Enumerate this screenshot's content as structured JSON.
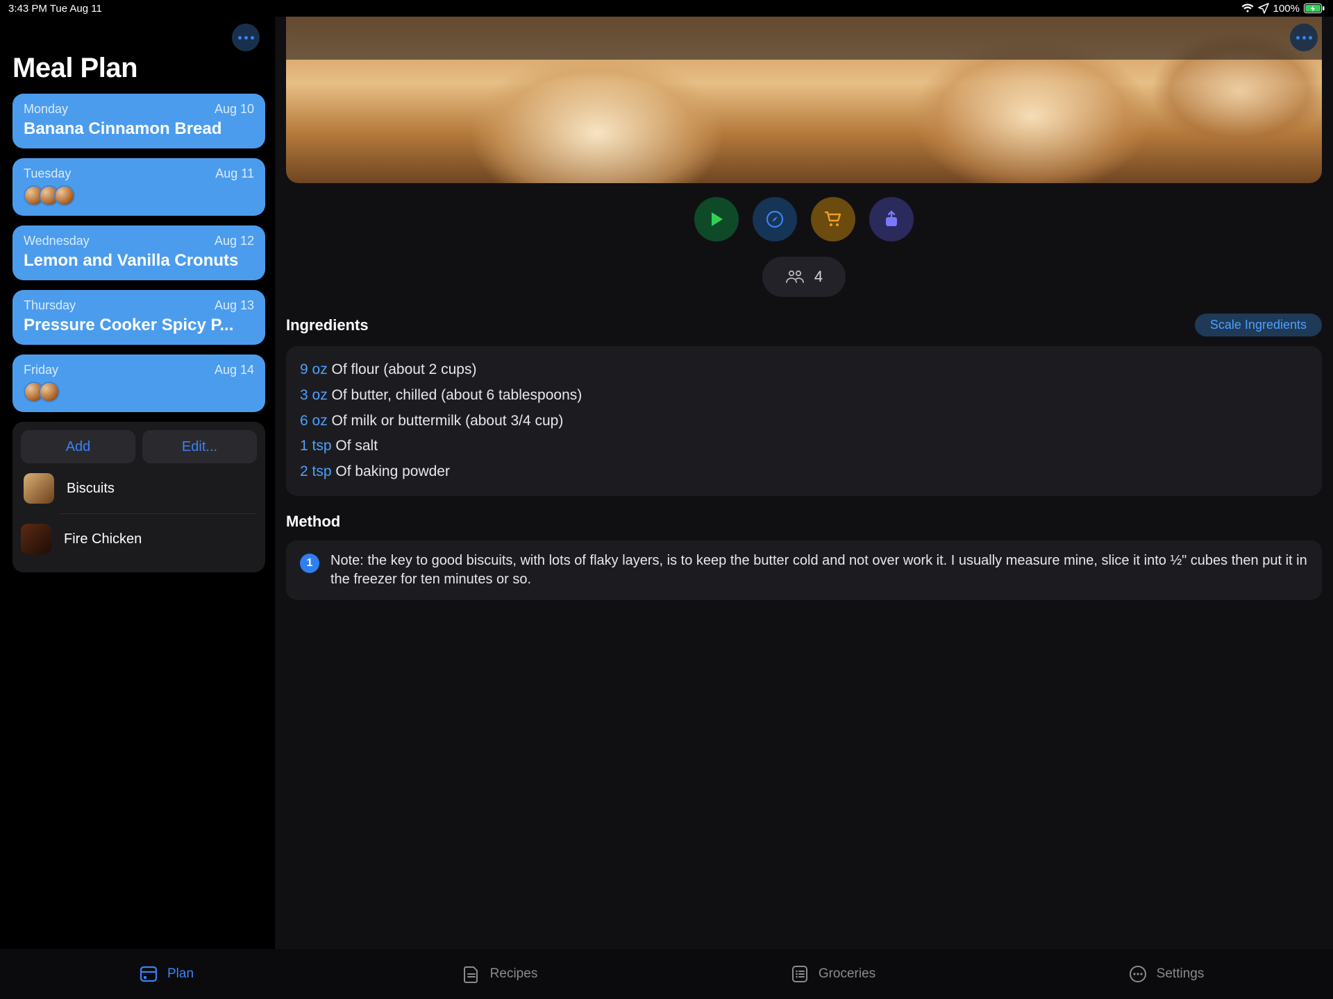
{
  "statusbar": {
    "time_day": "3:43 PM   Tue Aug 11",
    "battery": "100%"
  },
  "sidebar": {
    "title": "Meal Plan",
    "days": [
      {
        "name": "Monday",
        "date": "Aug 10",
        "meal": "Banana Cinnamon Bread"
      },
      {
        "name": "Tuesday",
        "date": "Aug 11",
        "meal": ""
      },
      {
        "name": "Wednesday",
        "date": "Aug 12",
        "meal": "Lemon and Vanilla Cronuts"
      },
      {
        "name": "Thursday",
        "date": "Aug 13",
        "meal": "Pressure Cooker Spicy P..."
      },
      {
        "name": "Friday",
        "date": "Aug 14",
        "meal": ""
      }
    ],
    "add_label": "Add",
    "edit_label": "Edit...",
    "queue": [
      {
        "name": "Biscuits"
      },
      {
        "name": "Fire Chicken"
      }
    ]
  },
  "detail": {
    "servings": "4",
    "ingredients_title": "Ingredients",
    "scale_label": "Scale Ingredients",
    "ingredients": [
      {
        "amount": "9 oz",
        "text": "Of flour (about 2 cups)"
      },
      {
        "amount": "3 oz",
        "text": "Of butter, chilled (about 6 tablespoons)"
      },
      {
        "amount": "6 oz",
        "text": "Of milk or buttermilk (about  3/4 cup)"
      },
      {
        "amount": "1 tsp",
        "text": "Of salt"
      },
      {
        "amount": "2 tsp",
        "text": "Of baking powder"
      }
    ],
    "method_title": "Method",
    "method": [
      {
        "num": "1",
        "text": "Note: the key to good biscuits, with lots of flaky layers, is to keep the butter cold and not over work it. I usually measure mine, slice it into ½\" cubes then put it in the freezer for ten minutes or so."
      }
    ]
  },
  "tabs": {
    "plan": "Plan",
    "recipes": "Recipes",
    "groceries": "Groceries",
    "settings": "Settings"
  }
}
